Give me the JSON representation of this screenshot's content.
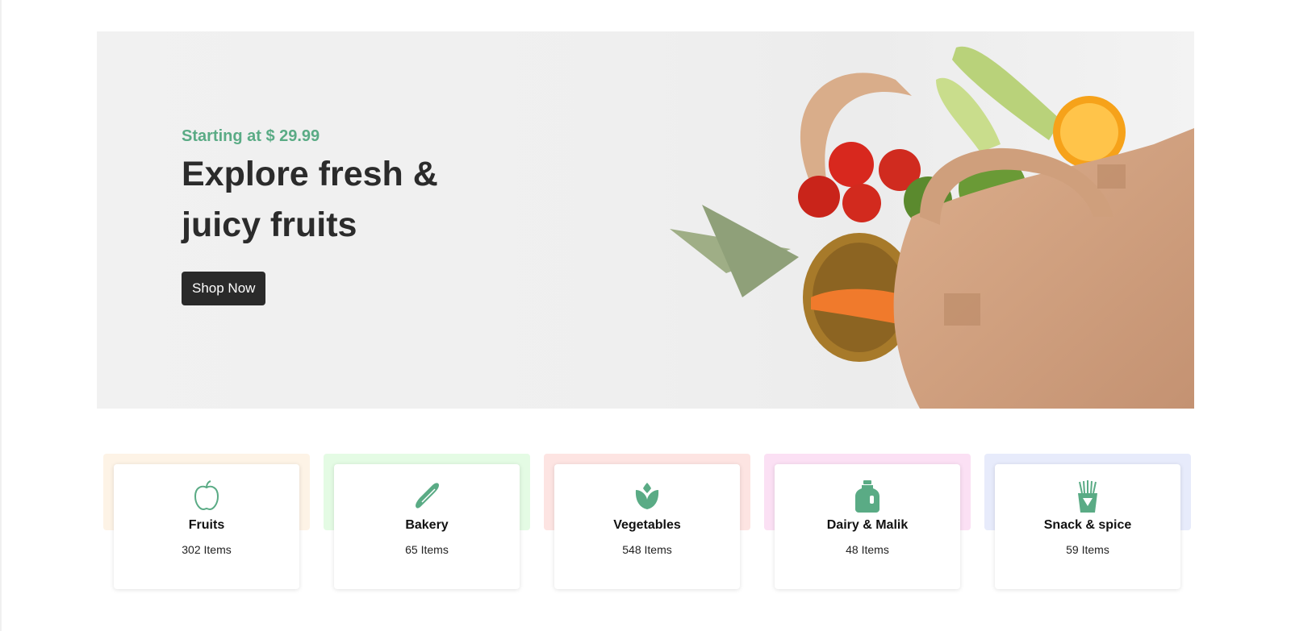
{
  "hero": {
    "subtitle": "Starting at $ 29.99",
    "title": "Explore fresh & juicy fruits",
    "button_label": "Shop Now"
  },
  "categories": [
    {
      "name": "Fruits",
      "count": "302 Items",
      "icon": "apple-icon",
      "bg": "#fdf3e6"
    },
    {
      "name": "Bakery",
      "count": "65 Items",
      "icon": "baguette-icon",
      "bg": "#e4fbe4"
    },
    {
      "name": "Vegetables",
      "count": "548 Items",
      "icon": "leaf-icon",
      "bg": "#fde4e2"
    },
    {
      "name": "Dairy & Malik",
      "count": "48 Items",
      "icon": "milk-jug-icon",
      "bg": "#fbe0f4"
    },
    {
      "name": "Snack & spice",
      "count": "59 Items",
      "icon": "fries-icon",
      "bg": "#e7ebfb"
    }
  ],
  "colors": {
    "accent": "#5aab85",
    "button_bg": "#2a2a2a",
    "title_text": "#2b2b2b"
  }
}
